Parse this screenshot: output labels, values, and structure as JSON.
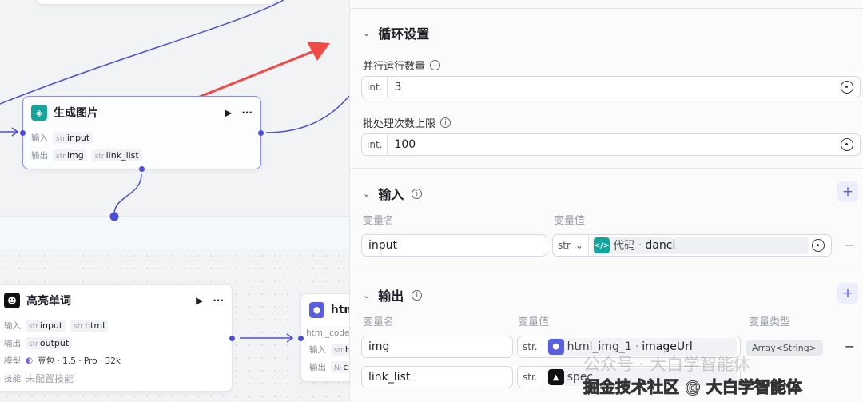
{
  "canvas": {
    "node_generate": {
      "title": "生成图片",
      "in_label": "输入",
      "out_label": "输出",
      "inputs": [
        {
          "type": "str",
          "name": "input"
        }
      ],
      "outputs": [
        {
          "type": "str",
          "name": "img"
        },
        {
          "type": "str",
          "name": "link_list"
        }
      ]
    },
    "node_highlight": {
      "title": "高亮单词",
      "in_label": "输入",
      "out_label": "输出",
      "model_label": "模型",
      "skill_label": "技能",
      "inputs": [
        {
          "type": "str",
          "name": "input"
        },
        {
          "type": "str",
          "name": "html"
        }
      ],
      "outputs": [
        {
          "type": "str",
          "name": "output"
        }
      ],
      "model": "豆包 · 1.5 · Pro · 32k",
      "skills": "未配置技能"
    },
    "node_html": {
      "title": "htm",
      "param": "html_code",
      "in_label": "输入",
      "out_label": "输出",
      "in_tag": {
        "type": "str",
        "name": "h"
      },
      "out_tag": {
        "type": "№",
        "name": "c"
      }
    },
    "colors": {
      "wire": "#4c4fd6",
      "arrow": "#ef4a45"
    }
  },
  "panel": {
    "loop": {
      "title": "循环设置",
      "parallel_label": "并行运行数量",
      "parallel_type": "int.",
      "parallel_value": "3",
      "batch_label": "批处理次数上限",
      "batch_type": "int.",
      "batch_value": "100"
    },
    "input": {
      "title": "输入",
      "col_name": "变量名",
      "col_value": "变量值",
      "rows": [
        {
          "name": "input",
          "type": "str",
          "ref_source": "代码",
          "ref_var": "danci"
        }
      ]
    },
    "output": {
      "title": "输出",
      "col_name": "变量名",
      "col_value": "变量值",
      "col_type": "变量类型",
      "rows": [
        {
          "name": "img",
          "type": "str.",
          "ref_source": "html_img_1",
          "ref_var": "imageUrl",
          "var_type": "Array<String>"
        },
        {
          "name": "link_list",
          "type": "str.",
          "ref_source": "spec",
          "ref_var": ""
        }
      ]
    }
  },
  "watermark": {
    "line1": "公众号 · 大白学智能体",
    "line2": "掘金技术社区 @ 大白学智能体"
  }
}
